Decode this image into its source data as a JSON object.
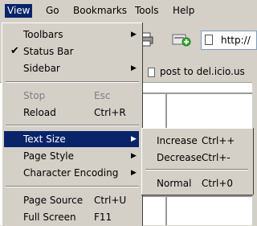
{
  "menubar": {
    "items": [
      {
        "label": "View"
      },
      {
        "label": "Go"
      },
      {
        "label": "Bookmarks"
      },
      {
        "label": "Tools"
      },
      {
        "label": "Help"
      }
    ]
  },
  "toolbar": {
    "url_text": "http://",
    "bookmark_label": "post to del.icio.us"
  },
  "view_menu": {
    "toolbars": "Toolbars",
    "status_bar": "Status Bar",
    "status_bar_checked": "✔",
    "sidebar": "Sidebar",
    "stop": "Stop",
    "stop_shortcut": "Esc",
    "reload": "Reload",
    "reload_shortcut": "Ctrl+R",
    "text_size": "Text Size",
    "page_style": "Page Style",
    "character_encoding": "Character Encoding",
    "page_source": "Page Source",
    "page_source_shortcut": "Ctrl+U",
    "full_screen": "Full Screen",
    "full_screen_shortcut": "F11"
  },
  "text_size_submenu": {
    "increase": "Increase",
    "increase_shortcut": "Ctrl++",
    "decrease": "Decrease",
    "decrease_shortcut": "Ctrl+-",
    "normal": "Normal",
    "normal_shortcut": "Ctrl+0"
  },
  "colors": {
    "highlight": "#0a246a",
    "menu_bg": "#d4d0c8",
    "disabled_text": "#808080"
  }
}
